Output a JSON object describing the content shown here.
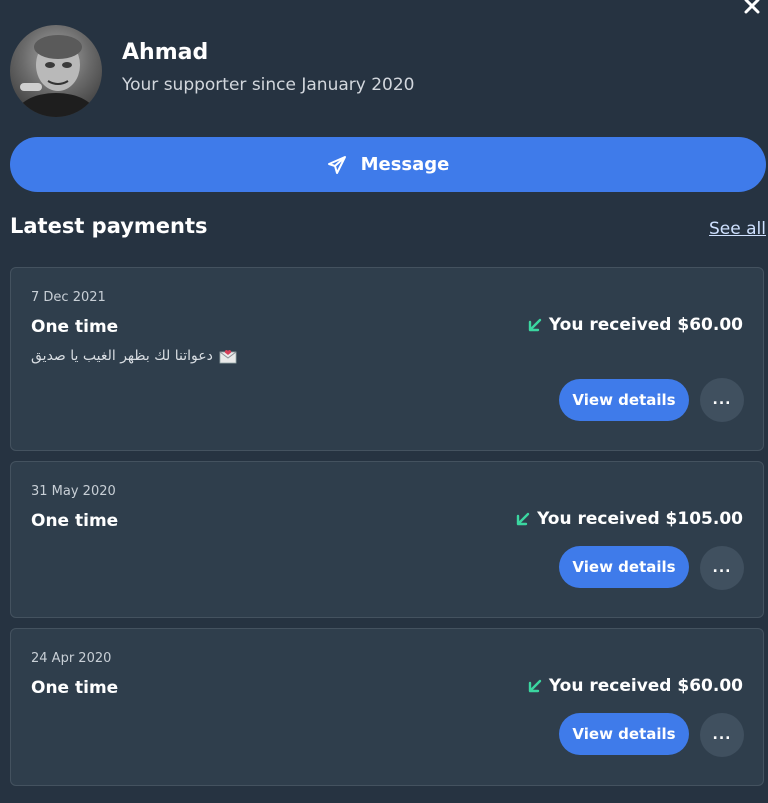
{
  "supporter": {
    "name": "Ahmad",
    "since": "Your supporter since January 2020"
  },
  "actions": {
    "message_label": "Message"
  },
  "payments_section": {
    "title": "Latest payments",
    "see_all": "See all"
  },
  "payments": [
    {
      "date": "7 Dec 2021",
      "type": "One time",
      "note": "دعواتنا لك بظهر الغيب يا صديق",
      "received": "You received $60.00",
      "view_label": "View details",
      "more_label": "..."
    },
    {
      "date": "31 May 2020",
      "type": "One time",
      "received": "You received $105.00",
      "view_label": "View details",
      "more_label": "..."
    },
    {
      "date": "24 Apr 2020",
      "type": "One time",
      "received": "You received $60.00",
      "view_label": "View details",
      "more_label": "..."
    }
  ],
  "colors": {
    "background": "#263341",
    "card": "#2f3e4c",
    "accent": "#3f7bea",
    "received_arrow": "#3bd6a0"
  },
  "icons": {
    "close": "close-icon",
    "message": "send-icon",
    "received": "arrow-down-left-icon",
    "note": "envelope-heart-icon",
    "more": "more-dots-icon"
  }
}
